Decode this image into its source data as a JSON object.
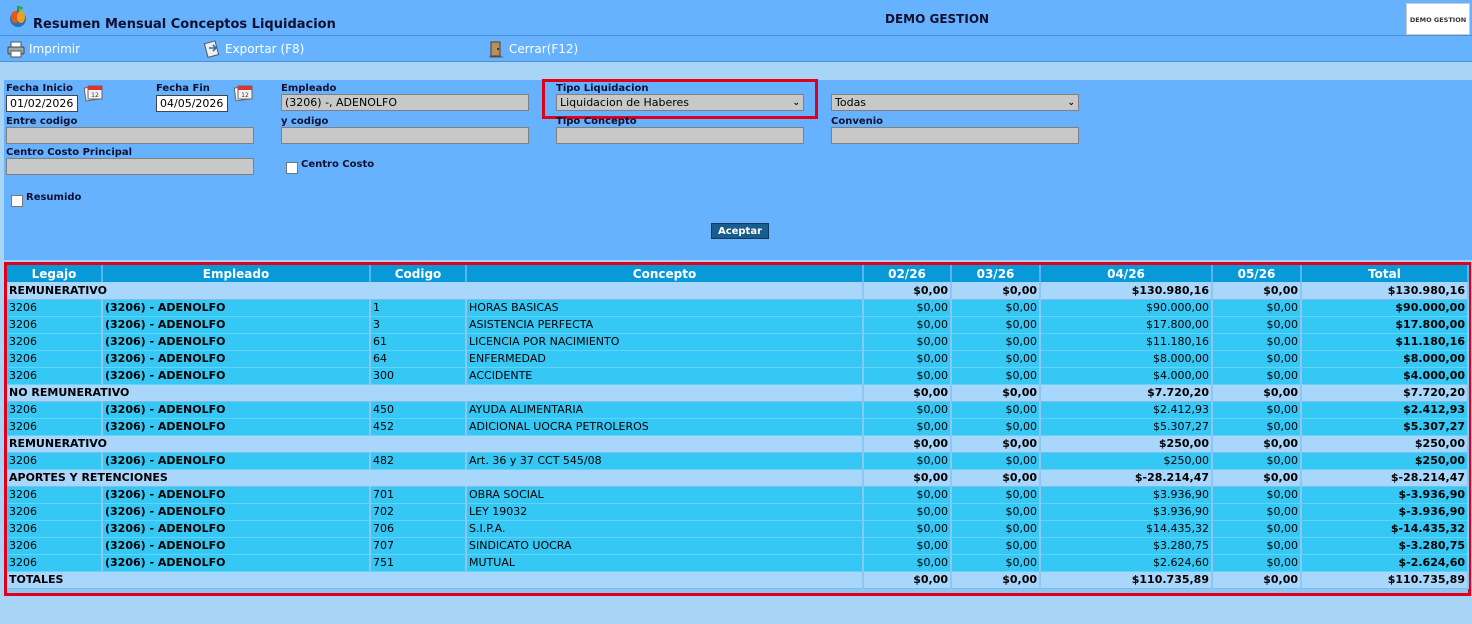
{
  "header": {
    "title": "Resumen Mensual Conceptos Liquidacion",
    "company": "DEMO GESTION",
    "brand_text": "DEMO GESTION"
  },
  "toolbar": {
    "print_label": "Imprimir",
    "export_label": "Exportar (F8)",
    "close_label": "Cerrar(F12)"
  },
  "filters": {
    "fecha_inicio_label": "Fecha Inicio",
    "fecha_inicio_value": "01/02/2026",
    "fecha_fin_label": "Fecha Fin",
    "fecha_fin_value": "04/05/2026",
    "empleado_label": "Empleado",
    "empleado_value": "(3206) -, ADENOLFO",
    "tipo_liquidacion_label": "Tipo Liquidacion",
    "tipo_liquidacion_value": "Liquidacion de Haberes",
    "todas_value": "Todas",
    "entre_codigo_label": "Entre codigo",
    "entre_codigo_value": "",
    "y_codigo_label": "y codigo",
    "y_codigo_value": "",
    "tipo_concepto_label": "Tipo Concepto",
    "tipo_concepto_value": "",
    "convenio_label": "Convenio",
    "convenio_value": "",
    "centro_costo_principal_label": "Centro Costo Principal",
    "centro_costo_principal_value": "",
    "centro_costo_label": "Centro Costo",
    "resumido_label": "Resumido",
    "accept_label": "Aceptar"
  },
  "table": {
    "columns": [
      "Legajo",
      "Empleado",
      "Codigo",
      "Concepto",
      "02/26",
      "03/26",
      "04/26",
      "05/26",
      "Total"
    ],
    "rows": [
      {
        "type": "group",
        "cells": [
          "REMUNERATIVO",
          "",
          "",
          "",
          "$0,00",
          "$0,00",
          "$130.980,16",
          "$0,00",
          "$130.980,16"
        ]
      },
      {
        "type": "detail",
        "cells": [
          "3206",
          "(3206) - ADENOLFO",
          "1",
          "HORAS BASICAS",
          "$0,00",
          "$0,00",
          "$90.000,00",
          "$0,00",
          "$90.000,00"
        ]
      },
      {
        "type": "detail",
        "cells": [
          "3206",
          "(3206) - ADENOLFO",
          "3",
          "ASISTENCIA PERFECTA",
          "$0,00",
          "$0,00",
          "$17.800,00",
          "$0,00",
          "$17.800,00"
        ]
      },
      {
        "type": "detail",
        "cells": [
          "3206",
          "(3206) - ADENOLFO",
          "61",
          "LICENCIA POR NACIMIENTO",
          "$0,00",
          "$0,00",
          "$11.180,16",
          "$0,00",
          "$11.180,16"
        ]
      },
      {
        "type": "detail",
        "cells": [
          "3206",
          "(3206) - ADENOLFO",
          "64",
          "ENFERMEDAD",
          "$0,00",
          "$0,00",
          "$8.000,00",
          "$0,00",
          "$8.000,00"
        ]
      },
      {
        "type": "detail",
        "cells": [
          "3206",
          "(3206) - ADENOLFO",
          "300",
          "ACCIDENTE",
          "$0,00",
          "$0,00",
          "$4.000,00",
          "$0,00",
          "$4.000,00"
        ]
      },
      {
        "type": "group",
        "cells": [
          "NO REMUNERATIVO",
          "",
          "",
          "",
          "$0,00",
          "$0,00",
          "$7.720,20",
          "$0,00",
          "$7.720,20"
        ]
      },
      {
        "type": "detail",
        "cells": [
          "3206",
          "(3206) - ADENOLFO",
          "450",
          "AYUDA ALIMENTARIA",
          "$0,00",
          "$0,00",
          "$2.412,93",
          "$0,00",
          "$2.412,93"
        ]
      },
      {
        "type": "detail",
        "cells": [
          "3206",
          "(3206) - ADENOLFO",
          "452",
          "ADICIONAL UOCRA PETROLEROS",
          "$0,00",
          "$0,00",
          "$5.307,27",
          "$0,00",
          "$5.307,27"
        ]
      },
      {
        "type": "group",
        "cells": [
          "REMUNERATIVO",
          "",
          "",
          "",
          "$0,00",
          "$0,00",
          "$250,00",
          "$0,00",
          "$250,00"
        ]
      },
      {
        "type": "detail",
        "cells": [
          "3206",
          "(3206) - ADENOLFO",
          "482",
          "Art. 36 y 37 CCT 545/08",
          "$0,00",
          "$0,00",
          "$250,00",
          "$0,00",
          "$250,00"
        ]
      },
      {
        "type": "group",
        "cells": [
          "APORTES Y RETENCIONES",
          "",
          "",
          "",
          "$0,00",
          "$0,00",
          "$-28.214,47",
          "$0,00",
          "$-28.214,47"
        ]
      },
      {
        "type": "detail",
        "cells": [
          "3206",
          "(3206) - ADENOLFO",
          "701",
          "OBRA SOCIAL",
          "$0,00",
          "$0,00",
          "$3.936,90",
          "$0,00",
          "$-3.936,90"
        ]
      },
      {
        "type": "detail",
        "cells": [
          "3206",
          "(3206) - ADENOLFO",
          "702",
          "LEY 19032",
          "$0,00",
          "$0,00",
          "$3.936,90",
          "$0,00",
          "$-3.936,90"
        ]
      },
      {
        "type": "detail",
        "cells": [
          "3206",
          "(3206) - ADENOLFO",
          "706",
          "S.I.P.A.",
          "$0,00",
          "$0,00",
          "$14.435,32",
          "$0,00",
          "$-14.435,32"
        ]
      },
      {
        "type": "detail",
        "cells": [
          "3206",
          "(3206) - ADENOLFO",
          "707",
          "SINDICATO UOCRA",
          "$0,00",
          "$0,00",
          "$3.280,75",
          "$0,00",
          "$-3.280,75"
        ]
      },
      {
        "type": "detail",
        "cells": [
          "3206",
          "(3206) - ADENOLFO",
          "751",
          "MUTUAL",
          "$0,00",
          "$0,00",
          "$2.624,60",
          "$0,00",
          "$-2.624,60"
        ]
      },
      {
        "type": "group",
        "cells": [
          "TOTALES",
          "",
          "",
          "",
          "$0,00",
          "$0,00",
          "$110.735,89",
          "$0,00",
          "$110.735,89"
        ]
      }
    ]
  }
}
